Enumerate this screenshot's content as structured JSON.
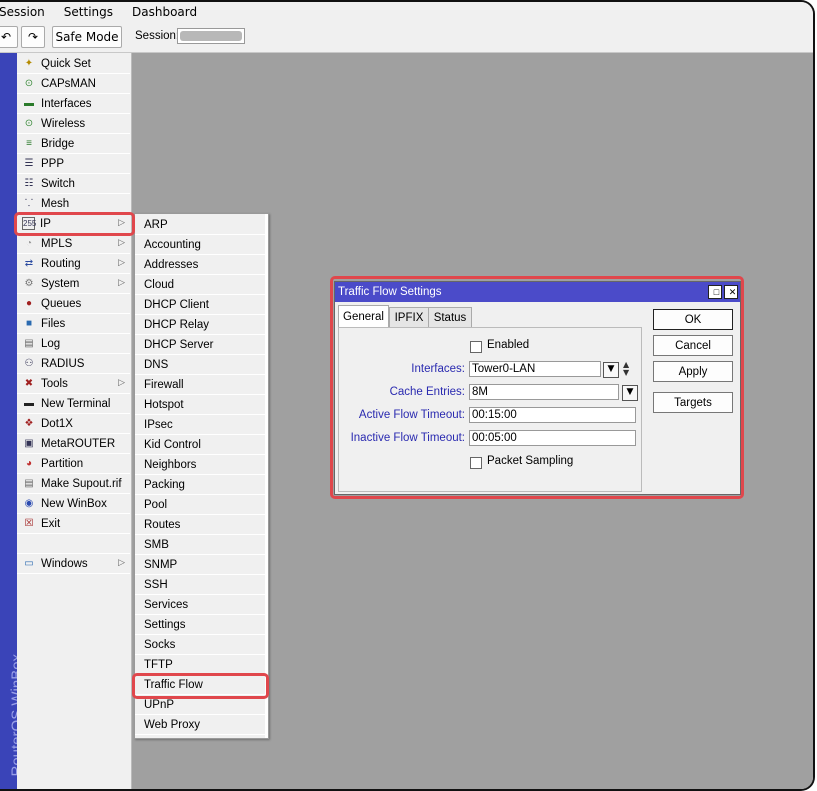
{
  "menubar": {
    "items": [
      "Session",
      "Settings",
      "Dashboard"
    ]
  },
  "toolbar": {
    "undo_icon": "undo-icon",
    "redo_icon": "redo-icon",
    "safe_mode_label": "Safe Mode",
    "session_label": "Session:",
    "session_value": ""
  },
  "sidebar": {
    "brand": "RouterOS WinBox",
    "items": [
      {
        "label": "Quick Set",
        "icon": "wand-icon",
        "arrow": false
      },
      {
        "label": "CAPsMAN",
        "icon": "antenna-icon",
        "arrow": false
      },
      {
        "label": "Interfaces",
        "icon": "interfaces-icon",
        "arrow": false
      },
      {
        "label": "Wireless",
        "icon": "wireless-icon",
        "arrow": false
      },
      {
        "label": "Bridge",
        "icon": "bridge-icon",
        "arrow": false
      },
      {
        "label": "PPP",
        "icon": "ppp-icon",
        "arrow": false
      },
      {
        "label": "Switch",
        "icon": "switch-icon",
        "arrow": false
      },
      {
        "label": "Mesh",
        "icon": "mesh-icon",
        "arrow": false
      },
      {
        "label": "IP",
        "icon": "ip-icon",
        "arrow": true
      },
      {
        "label": "MPLS",
        "icon": "mpls-icon",
        "arrow": true
      },
      {
        "label": "Routing",
        "icon": "routing-icon",
        "arrow": true
      },
      {
        "label": "System",
        "icon": "gear-icon",
        "arrow": true
      },
      {
        "label": "Queues",
        "icon": "queues-icon",
        "arrow": false
      },
      {
        "label": "Files",
        "icon": "folder-icon",
        "arrow": false
      },
      {
        "label": "Log",
        "icon": "log-icon",
        "arrow": false
      },
      {
        "label": "RADIUS",
        "icon": "radius-icon",
        "arrow": false
      },
      {
        "label": "Tools",
        "icon": "tools-icon",
        "arrow": true
      },
      {
        "label": "New Terminal",
        "icon": "terminal-icon",
        "arrow": false
      },
      {
        "label": "Dot1X",
        "icon": "dot1x-icon",
        "arrow": false
      },
      {
        "label": "MetaROUTER",
        "icon": "metarouter-icon",
        "arrow": false
      },
      {
        "label": "Partition",
        "icon": "pie-icon",
        "arrow": false
      },
      {
        "label": "Make Supout.rif",
        "icon": "document-icon",
        "arrow": false
      },
      {
        "label": "New WinBox",
        "icon": "globe-icon",
        "arrow": false
      },
      {
        "label": "Exit",
        "icon": "exit-icon",
        "arrow": false
      },
      {
        "label": "",
        "icon": "",
        "arrow": false
      },
      {
        "label": "Windows",
        "icon": "window-icon",
        "arrow": true
      }
    ]
  },
  "ip_submenu": {
    "items": [
      "ARP",
      "Accounting",
      "Addresses",
      "Cloud",
      "DHCP Client",
      "DHCP Relay",
      "DHCP Server",
      "DNS",
      "Firewall",
      "Hotspot",
      "IPsec",
      "Kid Control",
      "Neighbors",
      "Packing",
      "Pool",
      "Routes",
      "SMB",
      "SNMP",
      "SSH",
      "Services",
      "Settings",
      "Socks",
      "TFTP",
      "Traffic Flow",
      "UPnP",
      "Web Proxy"
    ]
  },
  "dialog": {
    "title": "Traffic Flow Settings",
    "tabs": [
      "General",
      "IPFIX",
      "Status"
    ],
    "enabled_label": "Enabled",
    "interfaces_label": "Interfaces:",
    "interfaces_value": "Tower0-LAN",
    "cache_label": "Cache Entries:",
    "cache_value": "8M",
    "active_timeout_label": "Active Flow Timeout:",
    "active_timeout_value": "00:15:00",
    "inactive_timeout_label": "Inactive Flow Timeout:",
    "inactive_timeout_value": "00:05:00",
    "packet_sampling_label": "Packet Sampling",
    "buttons": {
      "ok": "OK",
      "cancel": "Cancel",
      "apply": "Apply",
      "targets": "Targets"
    }
  },
  "colors": {
    "highlight": "#e0474c",
    "title_bar": "#4b4bc9",
    "label_blue": "#2a2ab0",
    "desktop": "#a0a0a0"
  }
}
